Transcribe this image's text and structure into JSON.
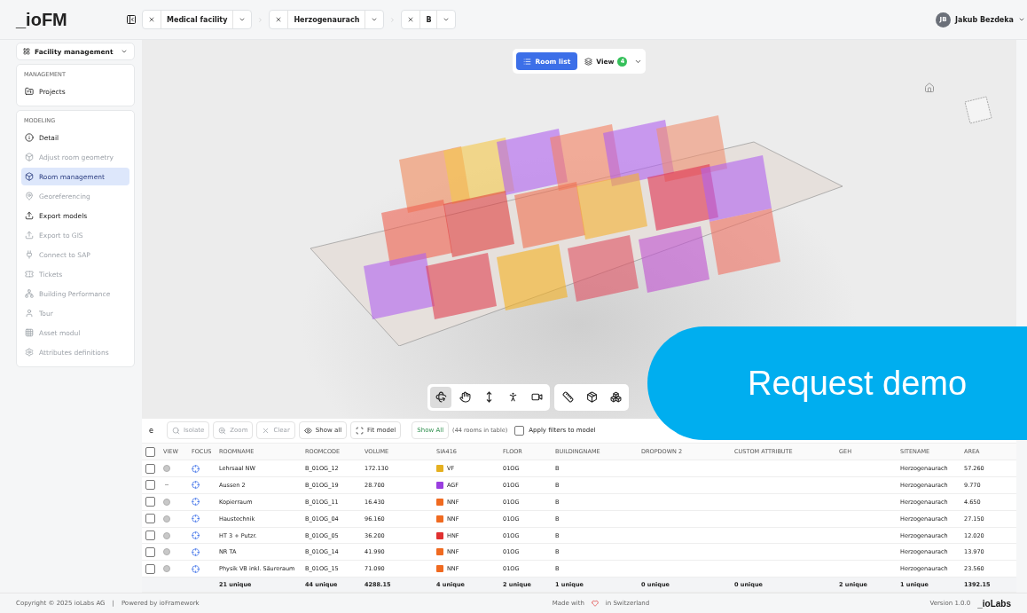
{
  "logo": "_ioFM",
  "breadcrumbs": [
    {
      "label": "Medical facility"
    },
    {
      "label": "Herzogenaurach"
    },
    {
      "label": "B"
    }
  ],
  "user": {
    "initials": "JB",
    "name": "Jakub Bezdeka"
  },
  "sidebar": {
    "module": "Facility management",
    "sections": [
      {
        "title": "MANAGEMENT",
        "items": [
          {
            "label": "Projects",
            "disabled": false,
            "selected": false
          }
        ]
      },
      {
        "title": "MODELING",
        "items": [
          {
            "label": "Detail",
            "disabled": false,
            "selected": false
          },
          {
            "label": "Adjust room geometry",
            "disabled": true,
            "selected": false
          },
          {
            "label": "Room management",
            "disabled": false,
            "selected": true
          },
          {
            "label": "Georeferencing",
            "disabled": true,
            "selected": false
          },
          {
            "label": "Export models",
            "disabled": false,
            "selected": false
          },
          {
            "label": "Export to GIS",
            "disabled": true,
            "selected": false
          },
          {
            "label": "Connect to SAP",
            "disabled": true,
            "selected": false
          },
          {
            "label": "Tickets",
            "disabled": true,
            "selected": false
          },
          {
            "label": "Building Performance",
            "disabled": true,
            "selected": false
          },
          {
            "label": "Tour",
            "disabled": true,
            "selected": false
          },
          {
            "label": "Asset modul",
            "disabled": true,
            "selected": false
          },
          {
            "label": "Attributes definitions",
            "disabled": true,
            "selected": false
          }
        ]
      }
    ]
  },
  "viewer": {
    "room_list_button": "Room list",
    "view_button": "View",
    "view_count": "4",
    "tools": [
      {
        "selected": true
      },
      {
        "selected": false
      },
      {
        "selected": false
      },
      {
        "selected": false
      },
      {
        "selected": false
      }
    ]
  },
  "banner": {
    "label": "Request demo"
  },
  "table_toolbar": {
    "search_value": "e",
    "buttons": [
      {
        "label": "Isolate",
        "disabled": true
      },
      {
        "label": "Zoom",
        "disabled": true
      },
      {
        "label": "Clear",
        "disabled": true
      },
      {
        "label": "Show all",
        "disabled": false
      },
      {
        "label": "Fit model",
        "disabled": false
      }
    ],
    "show_all": "Show All",
    "count": "(44 rooms in table)",
    "apply_filters": {
      "label": "Apply filters to model",
      "checked": false
    }
  },
  "table": {
    "select_all_checked": false,
    "columns": [
      "VIEW",
      "FOCUS",
      "ROOMNAME",
      "ROOMCODE",
      "VOLUME",
      "SIA416",
      "FLOOR",
      "BUILDINGNAME",
      "DROPDOWN 2",
      "CUSTOM ATTRIBUTE",
      "GEH",
      "SITENAME",
      "AREA"
    ],
    "rows": [
      {
        "checked": false,
        "visible": true,
        "roomname": "Lehrsaal NW",
        "roomcode": "B_01OG_12",
        "volume": "172.130",
        "sia416": "VF",
        "color": "#e5b020",
        "floor": "01OG",
        "buildingname": "B",
        "sitename": "Herzogenaurach",
        "area": "57.260"
      },
      {
        "checked": false,
        "visible": false,
        "roomname": "Aussen 2",
        "roomcode": "B_01OG_19",
        "volume": "28.700",
        "sia416": "AGF",
        "color": "#9a3ee0",
        "floor": "01OG",
        "buildingname": "B",
        "sitename": "Herzogenaurach",
        "area": "9.770"
      },
      {
        "checked": false,
        "visible": true,
        "roomname": "Kopierraum",
        "roomcode": "B_01OG_11",
        "volume": "16.430",
        "sia416": "NNF",
        "color": "#f06a20",
        "floor": "01OG",
        "buildingname": "B",
        "sitename": "Herzogenaurach",
        "area": "4.650"
      },
      {
        "checked": false,
        "visible": true,
        "roomname": "Haustechnik",
        "roomcode": "B_01OG_04",
        "volume": "96.160",
        "sia416": "NNF",
        "color": "#f06a20",
        "floor": "01OG",
        "buildingname": "B",
        "sitename": "Herzogenaurach",
        "area": "27.150"
      },
      {
        "checked": false,
        "visible": true,
        "roomname": "HT 3 + Putzr.",
        "roomcode": "B_01OG_05",
        "volume": "36.200",
        "sia416": "HNF",
        "color": "#e03030",
        "floor": "01OG",
        "buildingname": "B",
        "sitename": "Herzogenaurach",
        "area": "12.020"
      },
      {
        "checked": false,
        "visible": true,
        "roomname": "NR TA",
        "roomcode": "B_01OG_14",
        "volume": "41.990",
        "sia416": "NNF",
        "color": "#f06a20",
        "floor": "01OG",
        "buildingname": "B",
        "sitename": "Herzogenaurach",
        "area": "13.970"
      },
      {
        "checked": false,
        "visible": true,
        "roomname": "Physik VB inkl. Säureraum",
        "roomcode": "B_01OG_15",
        "volume": "71.090",
        "sia416": "NNF",
        "color": "#f06a20",
        "floor": "01OG",
        "buildingname": "B",
        "sitename": "Herzogenaurach",
        "area": "23.560"
      }
    ],
    "summary": [
      "21 unique",
      "44 unique",
      "4288.15",
      "4 unique",
      "2 unique",
      "1 unique",
      "0 unique",
      "0 unique",
      "2 unique",
      "1 unique",
      "1392.15"
    ]
  },
  "footer": {
    "copyright": "Copyright © 2025 ioLabs AG",
    "separator": "|",
    "powered": "Powered by ioFramework",
    "made_with": "Made with",
    "made_in": "in Switzerland",
    "version": "Version 1.0.0",
    "brand": "_ioLabs"
  }
}
